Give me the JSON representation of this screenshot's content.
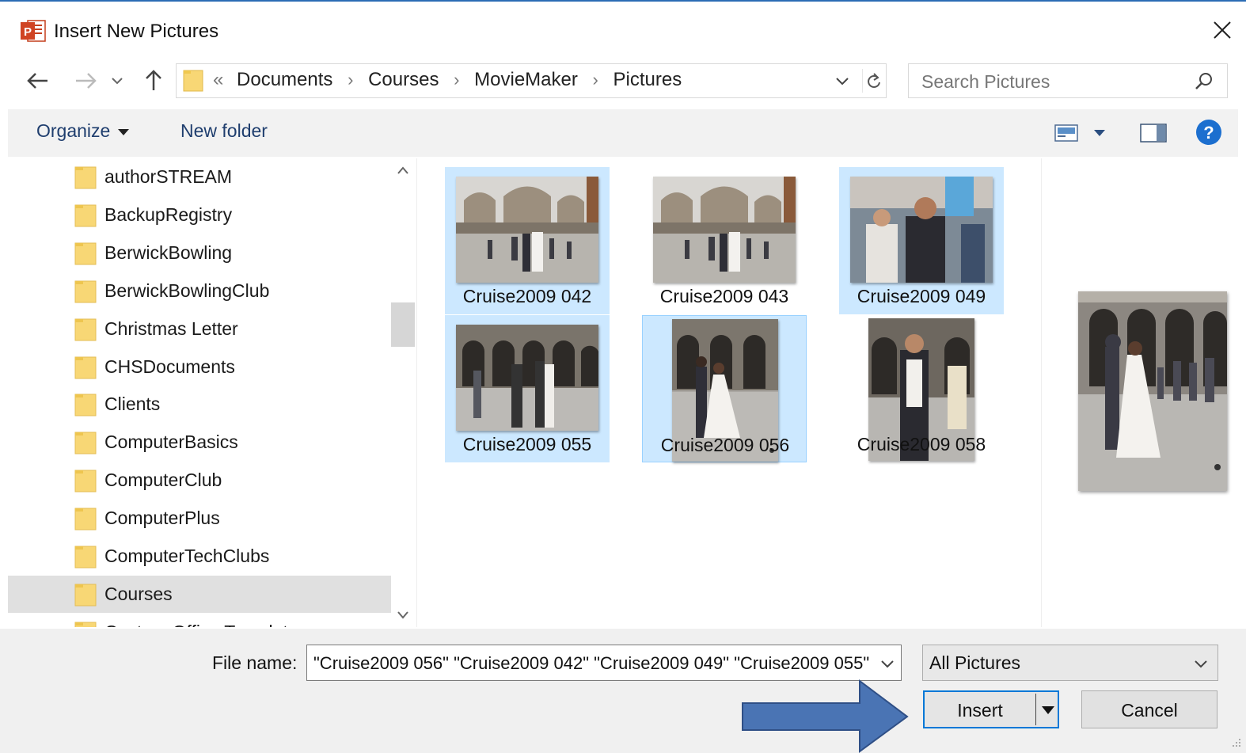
{
  "window": {
    "title": "Insert New Pictures",
    "app_icon": "powerpoint-icon",
    "close_icon": "close-icon"
  },
  "address": {
    "overflow": "«",
    "crumbs": [
      "Documents",
      "Courses",
      "MovieMaker",
      "Pictures"
    ],
    "search_placeholder": "Search Pictures"
  },
  "toolbar": {
    "organize_label": "Organize",
    "new_folder_label": "New folder",
    "help_label": "?"
  },
  "nav": {
    "folders": [
      {
        "label": "authorSTREAM",
        "selected": false
      },
      {
        "label": "BackupRegistry",
        "selected": false
      },
      {
        "label": "BerwickBowling",
        "selected": false
      },
      {
        "label": "BerwickBowlingClub",
        "selected": false
      },
      {
        "label": "Christmas Letter",
        "selected": false
      },
      {
        "label": "CHSDocuments",
        "selected": false
      },
      {
        "label": "Clients",
        "selected": false
      },
      {
        "label": "ComputerBasics",
        "selected": false
      },
      {
        "label": "ComputerClub",
        "selected": false
      },
      {
        "label": "ComputerPlus",
        "selected": false
      },
      {
        "label": "ComputerTechClubs",
        "selected": false
      },
      {
        "label": "Courses",
        "selected": true
      },
      {
        "label": "Custom Office Templates",
        "selected": false
      }
    ]
  },
  "files": [
    {
      "name": "Cruise2009 042",
      "selected": true,
      "focused": false
    },
    {
      "name": "Cruise2009 043",
      "selected": false,
      "focused": false
    },
    {
      "name": "Cruise2009 049",
      "selected": true,
      "focused": false
    },
    {
      "name": "Cruise2009 055",
      "selected": true,
      "focused": false
    },
    {
      "name": "Cruise2009 056",
      "selected": true,
      "focused": true
    },
    {
      "name": "Cruise2009 058",
      "selected": false,
      "focused": false
    }
  ],
  "footer": {
    "file_name_label": "File name:",
    "file_name_value": "\"Cruise2009 056\" \"Cruise2009 042\" \"Cruise2009 049\" \"Cruise2009 055\"",
    "file_type": "All Pictures",
    "insert_label": "Insert",
    "cancel_label": "Cancel"
  },
  "colors": {
    "accent": "#0078d7",
    "selection": "#cce8ff",
    "folder": "#f8d775",
    "callout_arrow": "#4a74b4"
  }
}
